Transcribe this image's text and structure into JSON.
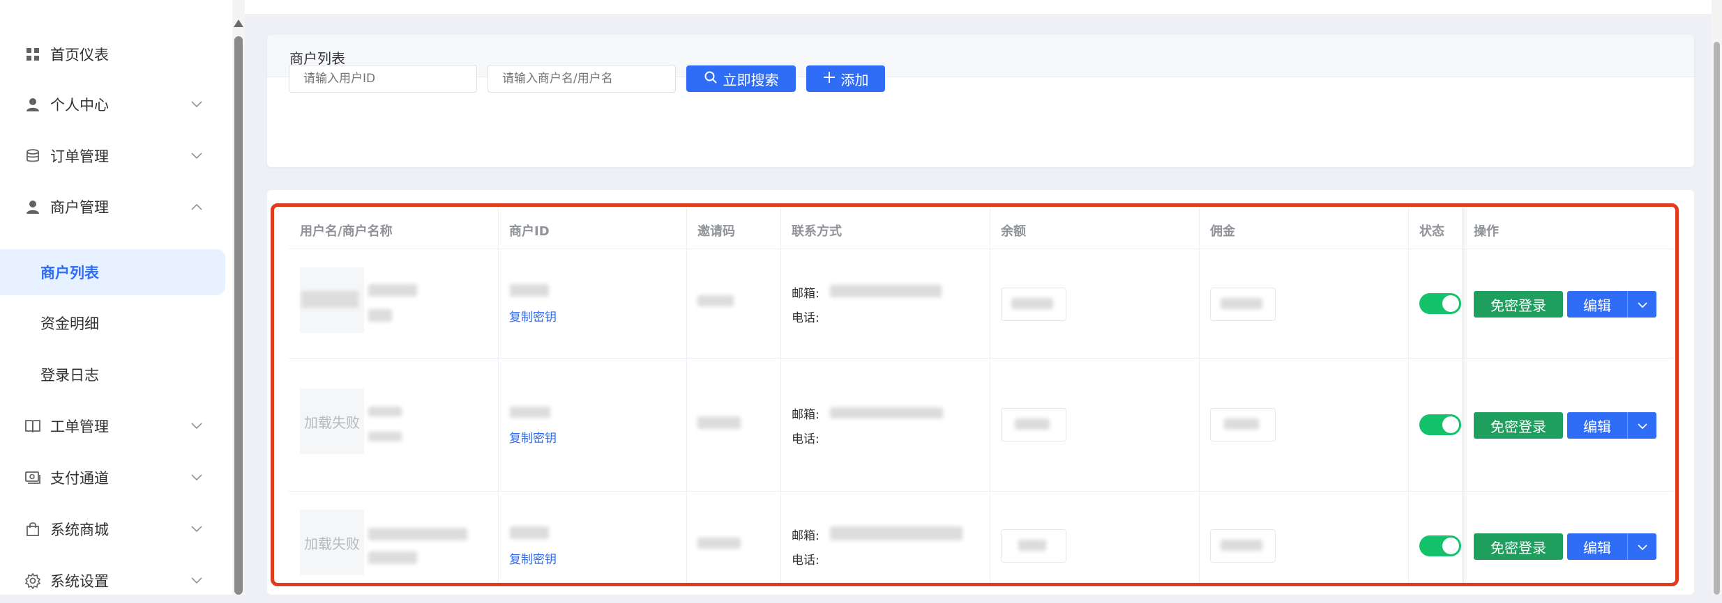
{
  "sidebar": {
    "items": [
      {
        "label": "首页仪表",
        "icon": "grid-icon",
        "arrow": ""
      },
      {
        "label": "个人中心",
        "icon": "user-icon",
        "arrow": "down"
      },
      {
        "label": "订单管理",
        "icon": "database-icon",
        "arrow": "down"
      },
      {
        "label": "商户管理",
        "icon": "user-icon",
        "arrow": "up"
      },
      {
        "label": "工单管理",
        "icon": "book-icon",
        "arrow": "down"
      },
      {
        "label": "支付通道",
        "icon": "payment-icon",
        "arrow": "down"
      },
      {
        "label": "系统商城",
        "icon": "shopping-bag-icon",
        "arrow": "down"
      },
      {
        "label": "系统设置",
        "icon": "gear-icon",
        "arrow": "down"
      }
    ],
    "subitems": [
      {
        "label": "商户列表",
        "active": true
      },
      {
        "label": "资金明细",
        "active": false
      },
      {
        "label": "登录日志",
        "active": false
      }
    ]
  },
  "search_card": {
    "title": "商户列表",
    "user_id_placeholder": "请输入用户ID",
    "merchant_placeholder": "请输入商户名/用户名",
    "search_button": "立即搜索",
    "add_button": "添加"
  },
  "table": {
    "headers": [
      "用户名/商户名称",
      "商户ID",
      "邀请码",
      "联系方式",
      "余额",
      "佣金",
      "状态",
      "操作"
    ],
    "rows": [
      {
        "image_text": "",
        "copy_key": "复制密钥",
        "email_label": "邮箱:",
        "phone_label": "电话:",
        "status_on": true,
        "login_button": "免密登录",
        "edit_button": "编辑"
      },
      {
        "image_text": "加载失败",
        "copy_key": "复制密钥",
        "email_label": "邮箱:",
        "phone_label": "电话:",
        "status_on": true,
        "login_button": "免密登录",
        "edit_button": "编辑"
      },
      {
        "image_text": "加载失败",
        "copy_key": "复制密钥",
        "email_label": "邮箱:",
        "phone_label": "电话:",
        "status_on": true,
        "login_button": "免密登录",
        "edit_button": "编辑"
      }
    ]
  },
  "colors": {
    "primary": "#2f6df6",
    "success": "#1e9f5e",
    "toggle_on": "#13c26a",
    "highlight_frame": "#e03a1f"
  }
}
